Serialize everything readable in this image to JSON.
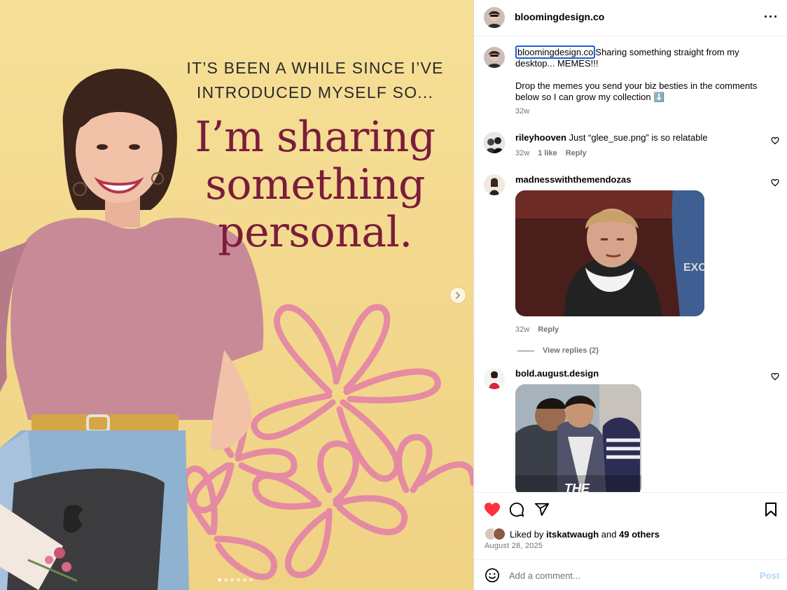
{
  "post": {
    "slide_text_small_1": "IT’S BEEN A WHILE SINCE I’VE",
    "slide_text_small_2": "INTRODUCED MYSELF SO...",
    "slide_text_big_1": "I’m sharing",
    "slide_text_big_2": "something",
    "slide_text_big_3": "personal.",
    "slide_count": 6,
    "active_slide": 1
  },
  "header": {
    "username": "bloomingdesign.co",
    "more_icon": "more-horizontal-icon"
  },
  "caption": {
    "username": "bloomingdesign.co",
    "line1": "Sharing something straight from my desktop... MEMES!!!",
    "line2": "Drop the memes you send your biz besties in the comments below so I can grow my collection ⬇️",
    "time": "32w"
  },
  "comments": [
    {
      "username": "rileyhooven",
      "text": "Just “glee_sue.png” is so relatable",
      "time": "32w",
      "likes": "1 like",
      "reply": "Reply"
    },
    {
      "username": "madnesswiththemendozas",
      "text": "",
      "time": "32w",
      "reply": "Reply",
      "view_replies": "View replies (2)"
    },
    {
      "username": "bold.august.design",
      "text": ""
    }
  ],
  "gif_texts": {
    "excel_fragment": "EXC",
    "meme_caption": "THE"
  },
  "actions": {
    "liked_prefix": "Liked by",
    "liked_user": "itskatwaugh",
    "liked_and": "and",
    "liked_others": "49 others",
    "date": "August 28, 2025",
    "icons": [
      "heart-filled-icon",
      "comment-icon",
      "share-icon",
      "bookmark-icon"
    ]
  },
  "add_comment": {
    "placeholder": "Add a comment...",
    "post_label": "Post"
  },
  "colors": {
    "heart": "#ff3040",
    "headline": "#7a1d3a",
    "link_blue": "#1d5fd8",
    "post_disabled": "#b2d3fb"
  }
}
